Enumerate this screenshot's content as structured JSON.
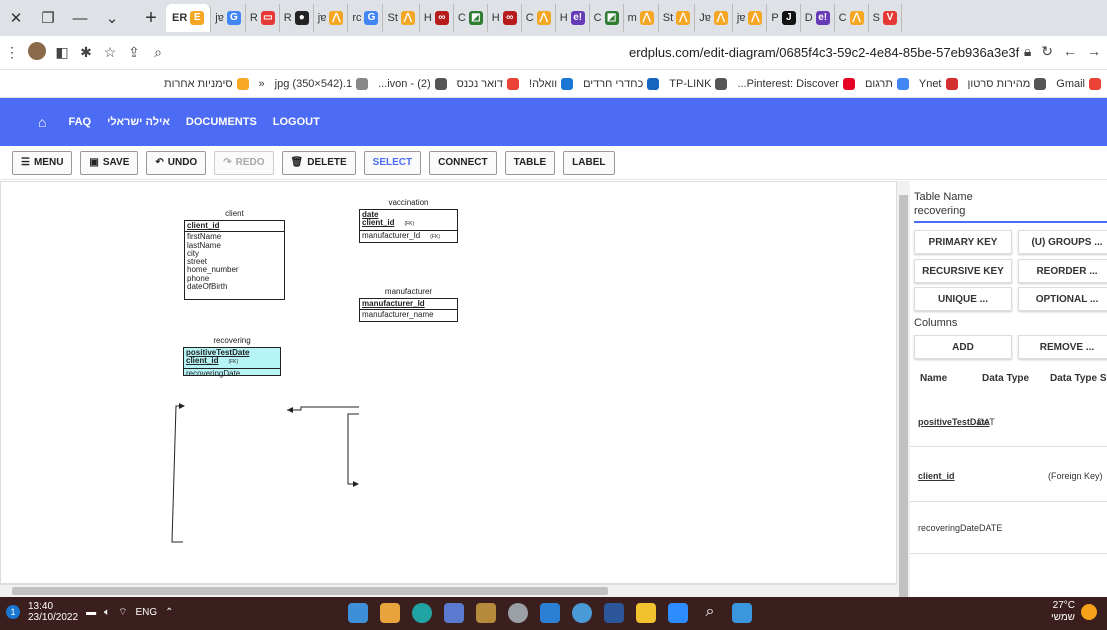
{
  "browser": {
    "tabs": [
      {
        "label": "ER",
        "fav": "E",
        "color": "#f5a623",
        "active": true
      },
      {
        "label": "jɐ",
        "fav": "G",
        "color": "#4285f4"
      },
      {
        "label": "R",
        "fav": "▭",
        "color": "#e53935"
      },
      {
        "label": "R",
        "fav": "●",
        "color": "#222"
      },
      {
        "label": "jɐ",
        "fav": "⋀",
        "color": "#f5a623"
      },
      {
        "label": "rc",
        "fav": "G",
        "color": "#4285f4"
      },
      {
        "label": "St",
        "fav": "⋀",
        "color": "#f5a623"
      },
      {
        "label": "H",
        "fav": "∞",
        "color": "#b71c1c"
      },
      {
        "label": "C",
        "fav": "◩",
        "color": "#2e7d32"
      },
      {
        "label": "H",
        "fav": "∞",
        "color": "#b71c1c"
      },
      {
        "label": "C",
        "fav": "⋀",
        "color": "#f5a623"
      },
      {
        "label": "H",
        "fav": "e!",
        "color": "#673ab7"
      },
      {
        "label": "C",
        "fav": "◩",
        "color": "#2e7d32"
      },
      {
        "label": "m",
        "fav": "⋀",
        "color": "#f5a623"
      },
      {
        "label": "St",
        "fav": "⋀",
        "color": "#f5a623"
      },
      {
        "label": "Jɐ",
        "fav": "⋀",
        "color": "#f5a623"
      },
      {
        "label": "jɐ",
        "fav": "⋀",
        "color": "#f5a623"
      },
      {
        "label": "P",
        "fav": "J",
        "color": "#111"
      },
      {
        "label": "D",
        "fav": "e!",
        "color": "#673ab7"
      },
      {
        "label": "C",
        "fav": "⋀",
        "color": "#f5a623"
      },
      {
        "label": "S",
        "fav": "V",
        "color": "#e53935"
      }
    ],
    "url": "erdplus.com/edit-diagram/0685f4c3-59c2-4e84-85be-57eb936a3e3f",
    "bookmarks": [
      {
        "label": "Gmail",
        "icon": "gmail-icon",
        "color": "#ea4335"
      },
      {
        "label": "מהירות סרטון",
        "icon": "chrome-icon",
        "color": "#555"
      },
      {
        "label": "Ynet",
        "icon": "ynet-icon",
        "color": "#d32f2f"
      },
      {
        "label": "תרגום",
        "icon": "translate-icon",
        "color": "#4285f4"
      },
      {
        "label": "Pinterest: Discover...",
        "icon": "pinterest-icon",
        "color": "#e60023"
      },
      {
        "label": "TP-LINK",
        "icon": "tplink-icon",
        "color": "#555"
      },
      {
        "label": "כחדרי חרדים",
        "icon": "monitor-icon",
        "color": "#1565c0"
      },
      {
        "label": "וואלה!",
        "icon": "walla-icon",
        "color": "#1976d2"
      },
      {
        "label": "דואר נכנס",
        "icon": "gmail-icon",
        "color": "#ea4335"
      },
      {
        "label": "(2) - ivon...",
        "icon": "chrome-icon",
        "color": "#555"
      },
      {
        "label": "1.jpg (350×542)",
        "icon": "image-icon",
        "color": "#888"
      },
      {
        "label": "«",
        "icon": "",
        "color": ""
      },
      {
        "label": "סימניות אחרות",
        "icon": "folder-icon",
        "color": "#f9a825"
      }
    ]
  },
  "appnav": {
    "items": [
      "FAQ",
      "אילה ישראלי",
      "DOCUMENTS",
      "LOGOUT"
    ]
  },
  "toolbar": {
    "menu": "MENU",
    "save": "SAVE",
    "undo": "UNDO",
    "redo": "REDO",
    "delete": "DELETE",
    "select": "SELECT",
    "connect": "CONNECT",
    "table": "TABLE",
    "label": "LABEL"
  },
  "diagram": {
    "client": {
      "name": "client",
      "pk": [
        "client_id"
      ],
      "attrs": [
        "firstName",
        "lastName",
        "city",
        "street",
        "home_number",
        "phone",
        "dateOfBirth"
      ]
    },
    "vaccination": {
      "name": "vaccination",
      "pk": [
        "date",
        "client_id"
      ],
      "fk_mark": "(FK)",
      "attrs": [
        "manufacturer_Id"
      ],
      "attr_fk": "(FK)"
    },
    "manufacturer": {
      "name": "manufacturer",
      "pk": [
        "manufacturer_Id"
      ],
      "attrs": [
        "manufacturer_name"
      ]
    },
    "recovering": {
      "name": "recovering",
      "pk": [
        "positiveTestDate",
        "client_id"
      ],
      "fk_mark": "(FK)",
      "attrs": [
        "recoveringDate"
      ]
    }
  },
  "panel": {
    "table_name_label": "Table Name",
    "table_name_value": "recovering",
    "buttons": {
      "primary_key": "PRIMARY KEY",
      "u_groups": "(U) GROUPS ...",
      "recursive_key": "RECURSIVE KEY",
      "reorder": "REORDER ...",
      "unique": "UNIQUE ...",
      "optional": "OPTIONAL ...",
      "add": "ADD",
      "remove": "REMOVE ..."
    },
    "columns_label": "Columns",
    "headers": {
      "name": "Name",
      "type": "Data Type",
      "size": "Data Type Siz"
    },
    "rows": [
      {
        "name": "positiveTestDate",
        "type": "DAT"
      },
      {
        "name": "client_id",
        "type": "(Foreign Key)"
      },
      {
        "name": "recoveringDate",
        "type": "DATE"
      }
    ]
  },
  "taskbar": {
    "time": "13:40",
    "date": "23/10/2022",
    "lang": "ENG",
    "temp": "27°C",
    "weather": "שמשי"
  }
}
